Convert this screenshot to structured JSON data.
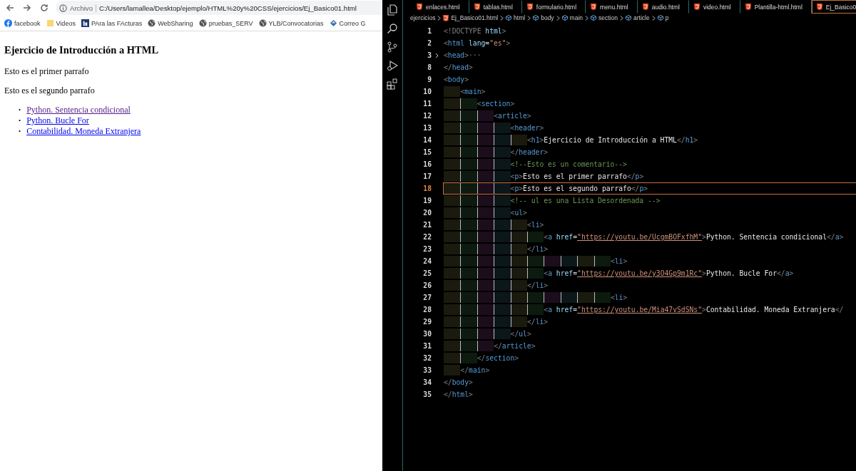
{
  "browser": {
    "address": {
      "scheme": "Archivo",
      "url": "C:/Users/lamallea/Desktop/ejemplo/HTML%20y%20CSS/ejercicios/Ej_Basico01.html"
    },
    "bookmarks": [
      {
        "kind": "facebook",
        "label": "facebook"
      },
      {
        "kind": "folder",
        "label": "Videos"
      },
      {
        "kind": "app",
        "label": "PAra las FActuras"
      },
      {
        "kind": "globe",
        "label": "WebSharing"
      },
      {
        "kind": "globe",
        "label": "pruebas_SERV"
      },
      {
        "kind": "globe",
        "label": "YLB/Convocatorias"
      },
      {
        "kind": "mail",
        "label": "Correo G"
      }
    ],
    "page": {
      "heading": "Ejercicio de Introducción a HTML",
      "paragraphs": [
        "Esto es el primer parrafo",
        "Esto es el segundo parrafo"
      ],
      "links": [
        {
          "marker": "•",
          "label": "Python. Sentencia condicional",
          "visited": true
        },
        {
          "marker": "•",
          "label": "Python. Bucle For",
          "visited": false
        },
        {
          "marker": "•",
          "label": "Contabilidad. Moneda Extranjera",
          "visited": false
        }
      ]
    }
  },
  "editor": {
    "tabs": [
      {
        "label": "enlaces.html",
        "selected": false
      },
      {
        "label": "tablas.html",
        "selected": false
      },
      {
        "label": "formulario.html",
        "selected": false
      },
      {
        "label": "menu.html",
        "selected": false
      },
      {
        "label": "audio.html",
        "selected": false
      },
      {
        "label": "video.html",
        "selected": false
      },
      {
        "label": "Plantilla-html.html",
        "selected": false
      },
      {
        "label": "Ej_Basico0",
        "selected": true
      }
    ],
    "breadcrumbs": [
      {
        "kind": "folder",
        "label": "ejercicios"
      },
      {
        "kind": "file",
        "label": "Ej_Basico01.html"
      },
      {
        "kind": "element",
        "label": "html"
      },
      {
        "kind": "element",
        "label": "body"
      },
      {
        "kind": "element",
        "label": "main"
      },
      {
        "kind": "element",
        "label": "section"
      },
      {
        "kind": "element",
        "label": "article"
      },
      {
        "kind": "element",
        "label": "p"
      }
    ],
    "lines": [
      {
        "number": "1",
        "current": false,
        "folded": false,
        "tokens": [
          {
            "kind": "punct",
            "text": "<!DOCTYPE "
          },
          {
            "kind": "attr",
            "text": "html"
          },
          {
            "kind": "punct",
            "text": ">"
          }
        ]
      },
      {
        "number": "2",
        "current": false,
        "folded": false,
        "tokens": [
          {
            "kind": "punct",
            "text": "<"
          },
          {
            "kind": "tag",
            "text": "html "
          },
          {
            "kind": "attr",
            "text": "lang"
          },
          {
            "kind": "plain",
            "text": "="
          },
          {
            "kind": "string",
            "text": "\"es\""
          },
          {
            "kind": "punct",
            "text": ">"
          }
        ]
      },
      {
        "number": "3",
        "current": false,
        "folded": true,
        "tokens": [
          {
            "kind": "punct",
            "text": "<"
          },
          {
            "kind": "tag",
            "text": "head"
          },
          {
            "kind": "punct",
            "text": ">"
          },
          {
            "kind": "punct",
            "text": "···"
          }
        ]
      },
      {
        "number": "8",
        "current": false,
        "folded": false,
        "tokens": [
          {
            "kind": "punct",
            "text": "</"
          },
          {
            "kind": "tag",
            "text": "head"
          },
          {
            "kind": "punct",
            "text": ">"
          }
        ]
      },
      {
        "number": "9",
        "current": false,
        "folded": false,
        "tokens": [
          {
            "kind": "punct",
            "text": "<"
          },
          {
            "kind": "tag",
            "text": "body"
          },
          {
            "kind": "punct",
            "text": ">"
          }
        ]
      },
      {
        "number": "10",
        "current": false,
        "folded": false,
        "guides": [
          {
            "color": "#1a1a0e"
          }
        ],
        "tokens": [
          {
            "kind": "punct",
            "text": "<"
          },
          {
            "kind": "tag",
            "text": "main"
          },
          {
            "kind": "punct",
            "text": ">"
          }
        ]
      },
      {
        "number": "11",
        "current": false,
        "folded": false,
        "guides": [
          {
            "color": "#1a1a0e"
          },
          {
            "color": "#0d1a10"
          }
        ],
        "tokens": [
          {
            "kind": "punct",
            "text": "<"
          },
          {
            "kind": "tag",
            "text": "section"
          },
          {
            "kind": "punct",
            "text": ">"
          }
        ]
      },
      {
        "number": "12",
        "current": false,
        "folded": false,
        "guides": [
          {
            "color": "#1a1a0e"
          },
          {
            "color": "#0d1a10"
          },
          {
            "color": "#1c0d1c"
          }
        ],
        "tokens": [
          {
            "kind": "punct",
            "text": "<"
          },
          {
            "kind": "tag",
            "text": "article"
          },
          {
            "kind": "punct",
            "text": ">"
          }
        ]
      },
      {
        "number": "13",
        "current": false,
        "folded": false,
        "guides": [
          {
            "color": "#1a1a0e"
          },
          {
            "color": "#0d1a10"
          },
          {
            "color": "#1c0d1c"
          },
          {
            "color": "#0c171a"
          }
        ],
        "tokens": [
          {
            "kind": "punct",
            "text": "<"
          },
          {
            "kind": "tag",
            "text": "header"
          },
          {
            "kind": "punct",
            "text": ">"
          }
        ]
      },
      {
        "number": "14",
        "current": false,
        "folded": false,
        "guides": [
          {
            "color": "#1a1a0e"
          },
          {
            "color": "#0d1a10"
          },
          {
            "color": "#1c0d1c"
          },
          {
            "color": "#0c171a"
          },
          {
            "color": "#1a1a0e"
          }
        ],
        "tokens": [
          {
            "kind": "punct",
            "text": "<"
          },
          {
            "kind": "tag",
            "text": "h1"
          },
          {
            "kind": "punct",
            "text": ">"
          },
          {
            "kind": "plain",
            "text": "Ejercicio de Introducción a HTML"
          },
          {
            "kind": "punct",
            "text": "</"
          },
          {
            "kind": "tag",
            "text": "h1"
          },
          {
            "kind": "punct",
            "text": ">"
          }
        ]
      },
      {
        "number": "15",
        "current": false,
        "folded": false,
        "guides": [
          {
            "color": "#1a1a0e"
          },
          {
            "color": "#0d1a10"
          },
          {
            "color": "#1c0d1c"
          },
          {
            "color": "#0c171a"
          }
        ],
        "tokens": [
          {
            "kind": "punct",
            "text": "</"
          },
          {
            "kind": "tag",
            "text": "header"
          },
          {
            "kind": "punct",
            "text": ">"
          }
        ]
      },
      {
        "number": "16",
        "current": false,
        "folded": false,
        "guides": [
          {
            "color": "#1a1a0e"
          },
          {
            "color": "#0d1a10"
          },
          {
            "color": "#1c0d1c"
          },
          {
            "color": "#0c171a"
          }
        ],
        "tokens": [
          {
            "kind": "comment",
            "text": "<!--Esto es un comentario-->"
          }
        ]
      },
      {
        "number": "17",
        "current": false,
        "folded": false,
        "guides": [
          {
            "color": "#1a1a0e"
          },
          {
            "color": "#0d1a10"
          },
          {
            "color": "#1c0d1c"
          },
          {
            "color": "#0c171a"
          }
        ],
        "tokens": [
          {
            "kind": "punct",
            "text": "<"
          },
          {
            "kind": "tag",
            "text": "p"
          },
          {
            "kind": "punct",
            "text": ">"
          },
          {
            "kind": "plain",
            "text": "Esto es el primer parrafo"
          },
          {
            "kind": "punct",
            "text": "</"
          },
          {
            "kind": "tag",
            "text": "p"
          },
          {
            "kind": "punct",
            "text": ">"
          }
        ]
      },
      {
        "number": "18",
        "current": true,
        "folded": false,
        "guides": [
          {
            "color": "#1a1a0e"
          },
          {
            "color": "#0d1a10"
          },
          {
            "color": "#1c0d1c"
          },
          {
            "color": "#0c171a"
          }
        ],
        "tokens": [
          {
            "kind": "punct",
            "text": "<"
          },
          {
            "kind": "tag",
            "text": "p"
          },
          {
            "kind": "punct",
            "text": ">"
          },
          {
            "kind": "plain",
            "text": "Esto es el segundo parrafo"
          },
          {
            "kind": "punct",
            "text": "</"
          },
          {
            "kind": "tag",
            "text": "p"
          },
          {
            "kind": "punct",
            "text": ">"
          }
        ]
      },
      {
        "number": "19",
        "current": false,
        "folded": false,
        "guides": [
          {
            "color": "#1a1a0e"
          },
          {
            "color": "#0d1a10"
          },
          {
            "color": "#1c0d1c"
          },
          {
            "color": "#0c171a"
          }
        ],
        "tokens": [
          {
            "kind": "comment",
            "text": "<!-- ul es una Lista Desordenada -->"
          }
        ]
      },
      {
        "number": "20",
        "current": false,
        "folded": false,
        "guides": [
          {
            "color": "#1a1a0e"
          },
          {
            "color": "#0d1a10"
          },
          {
            "color": "#1c0d1c"
          },
          {
            "color": "#0c171a"
          }
        ],
        "tokens": [
          {
            "kind": "punct",
            "text": "<"
          },
          {
            "kind": "tag",
            "text": "ul"
          },
          {
            "kind": "punct",
            "text": ">"
          }
        ]
      },
      {
        "number": "21",
        "current": false,
        "folded": false,
        "guides": [
          {
            "color": "#1a1a0e"
          },
          {
            "color": "#0d1a10"
          },
          {
            "color": "#1c0d1c"
          },
          {
            "color": "#0c171a"
          },
          {
            "color": "#1a1a0e"
          }
        ],
        "tokens": [
          {
            "kind": "punct",
            "text": "<"
          },
          {
            "kind": "tag",
            "text": "li"
          },
          {
            "kind": "punct",
            "text": ">"
          }
        ]
      },
      {
        "number": "22",
        "current": false,
        "folded": false,
        "guides": [
          {
            "color": "#1a1a0e"
          },
          {
            "color": "#0d1a10"
          },
          {
            "color": "#1c0d1c"
          },
          {
            "color": "#0c171a"
          },
          {
            "color": "#1a1a0e"
          },
          {
            "color": "#0d1a10"
          }
        ],
        "tokens": [
          {
            "kind": "punct",
            "text": "<"
          },
          {
            "kind": "tag",
            "text": "a "
          },
          {
            "kind": "attr",
            "text": "href"
          },
          {
            "kind": "plain",
            "text": "="
          },
          {
            "kind": "url",
            "text": "\"https://youtu.be/UcgmBOFxfhM\""
          },
          {
            "kind": "punct",
            "text": ">"
          },
          {
            "kind": "plain",
            "text": "Python. Sentencia condicional"
          },
          {
            "kind": "punct",
            "text": "</"
          },
          {
            "kind": "tag",
            "text": "a"
          },
          {
            "kind": "punct",
            "text": ">"
          }
        ]
      },
      {
        "number": "23",
        "current": false,
        "folded": false,
        "guides": [
          {
            "color": "#1a1a0e"
          },
          {
            "color": "#0d1a10"
          },
          {
            "color": "#1c0d1c"
          },
          {
            "color": "#0c171a"
          },
          {
            "color": "#1a1a0e"
          }
        ],
        "tokens": [
          {
            "kind": "punct",
            "text": "</"
          },
          {
            "kind": "tag",
            "text": "li"
          },
          {
            "kind": "punct",
            "text": ">"
          }
        ]
      },
      {
        "number": "24",
        "current": false,
        "folded": false,
        "guides": [
          {
            "color": "#1a1a0e"
          },
          {
            "color": "#0d1a10"
          },
          {
            "color": "#1c0d1c"
          },
          {
            "color": "#0c171a"
          },
          {
            "color": "#1a1a0e"
          },
          {
            "color": "#0d1a10"
          },
          {
            "color": "#1c0d1c"
          },
          {
            "color": "#0c171a"
          },
          {
            "color": "#1a1a0e"
          },
          {
            "color": "#0d1a10"
          }
        ],
        "tokens": [
          {
            "kind": "punct",
            "text": "<"
          },
          {
            "kind": "tag",
            "text": "li"
          },
          {
            "kind": "punct",
            "text": ">"
          }
        ]
      },
      {
        "number": "25",
        "current": false,
        "folded": false,
        "guides": [
          {
            "color": "#1a1a0e"
          },
          {
            "color": "#0d1a10"
          },
          {
            "color": "#1c0d1c"
          },
          {
            "color": "#0c171a"
          },
          {
            "color": "#1a1a0e"
          },
          {
            "color": "#0d1a10"
          }
        ],
        "tokens": [
          {
            "kind": "punct",
            "text": "<"
          },
          {
            "kind": "tag",
            "text": "a "
          },
          {
            "kind": "attr",
            "text": "href"
          },
          {
            "kind": "plain",
            "text": "="
          },
          {
            "kind": "url",
            "text": "\"https://youtu.be/y3O4Gp9m1Rc\""
          },
          {
            "kind": "punct",
            "text": ">"
          },
          {
            "kind": "plain",
            "text": "Python. Bucle For"
          },
          {
            "kind": "punct",
            "text": "</"
          },
          {
            "kind": "tag",
            "text": "a"
          },
          {
            "kind": "punct",
            "text": ">"
          }
        ]
      },
      {
        "number": "26",
        "current": false,
        "folded": false,
        "guides": [
          {
            "color": "#1a1a0e"
          },
          {
            "color": "#0d1a10"
          },
          {
            "color": "#1c0d1c"
          },
          {
            "color": "#0c171a"
          },
          {
            "color": "#1a1a0e"
          }
        ],
        "tokens": [
          {
            "kind": "punct",
            "text": "</"
          },
          {
            "kind": "tag",
            "text": "li"
          },
          {
            "kind": "punct",
            "text": ">"
          }
        ]
      },
      {
        "number": "27",
        "current": false,
        "folded": false,
        "guides": [
          {
            "color": "#1a1a0e"
          },
          {
            "color": "#0d1a10"
          },
          {
            "color": "#1c0d1c"
          },
          {
            "color": "#0c171a"
          },
          {
            "color": "#1a1a0e"
          },
          {
            "color": "#0d1a10"
          },
          {
            "color": "#1c0d1c"
          },
          {
            "color": "#0c171a"
          },
          {
            "color": "#1a1a0e"
          },
          {
            "color": "#0d1a10"
          }
        ],
        "tokens": [
          {
            "kind": "punct",
            "text": "<"
          },
          {
            "kind": "tag",
            "text": "li"
          },
          {
            "kind": "punct",
            "text": ">"
          }
        ]
      },
      {
        "number": "28",
        "current": false,
        "folded": false,
        "guides": [
          {
            "color": "#1a1a0e"
          },
          {
            "color": "#0d1a10"
          },
          {
            "color": "#1c0d1c"
          },
          {
            "color": "#0c171a"
          },
          {
            "color": "#1a1a0e"
          },
          {
            "color": "#0d1a10"
          }
        ],
        "tokens": [
          {
            "kind": "punct",
            "text": "<"
          },
          {
            "kind": "tag",
            "text": "a "
          },
          {
            "kind": "attr",
            "text": "href"
          },
          {
            "kind": "plain",
            "text": "="
          },
          {
            "kind": "url",
            "text": "\"https://youtu.be/Mia47vSdSNs\""
          },
          {
            "kind": "punct",
            "text": ">"
          },
          {
            "kind": "plain",
            "text": "Contabilidad. Moneda Extranjera"
          },
          {
            "kind": "punct",
            "text": "</"
          }
        ]
      },
      {
        "number": "29",
        "current": false,
        "folded": false,
        "guides": [
          {
            "color": "#1a1a0e"
          },
          {
            "color": "#0d1a10"
          },
          {
            "color": "#1c0d1c"
          },
          {
            "color": "#0c171a"
          },
          {
            "color": "#1a1a0e"
          }
        ],
        "tokens": [
          {
            "kind": "punct",
            "text": "</"
          },
          {
            "kind": "tag",
            "text": "li"
          },
          {
            "kind": "punct",
            "text": ">"
          }
        ]
      },
      {
        "number": "30",
        "current": false,
        "folded": false,
        "guides": [
          {
            "color": "#1a1a0e"
          },
          {
            "color": "#0d1a10"
          },
          {
            "color": "#1c0d1c"
          },
          {
            "color": "#0c171a"
          }
        ],
        "tokens": [
          {
            "kind": "punct",
            "text": "</"
          },
          {
            "kind": "tag",
            "text": "ul"
          },
          {
            "kind": "punct",
            "text": ">"
          }
        ]
      },
      {
        "number": "31",
        "current": false,
        "folded": false,
        "guides": [
          {
            "color": "#1a1a0e"
          },
          {
            "color": "#0d1a10"
          },
          {
            "color": "#1c0d1c"
          }
        ],
        "tokens": [
          {
            "kind": "punct",
            "text": "</"
          },
          {
            "kind": "tag",
            "text": "article"
          },
          {
            "kind": "punct",
            "text": ">"
          }
        ]
      },
      {
        "number": "32",
        "current": false,
        "folded": false,
        "guides": [
          {
            "color": "#1a1a0e"
          },
          {
            "color": "#0d1a10"
          }
        ],
        "tokens": [
          {
            "kind": "punct",
            "text": "</"
          },
          {
            "kind": "tag",
            "text": "section"
          },
          {
            "kind": "punct",
            "text": ">"
          }
        ]
      },
      {
        "number": "33",
        "current": false,
        "folded": false,
        "guides": [
          {
            "color": "#1a1a0e"
          }
        ],
        "tokens": [
          {
            "kind": "punct",
            "text": "</"
          },
          {
            "kind": "tag",
            "text": "main"
          },
          {
            "kind": "punct",
            "text": ">"
          }
        ]
      },
      {
        "number": "34",
        "current": false,
        "folded": false,
        "tokens": [
          {
            "kind": "punct",
            "text": "</"
          },
          {
            "kind": "tag",
            "text": "body"
          },
          {
            "kind": "punct",
            "text": ">"
          }
        ]
      },
      {
        "number": "35",
        "current": false,
        "folded": false,
        "tokens": [
          {
            "kind": "punct",
            "text": "</"
          },
          {
            "kind": "tag",
            "text": "html"
          },
          {
            "kind": "punct",
            "text": ">"
          }
        ]
      }
    ]
  }
}
